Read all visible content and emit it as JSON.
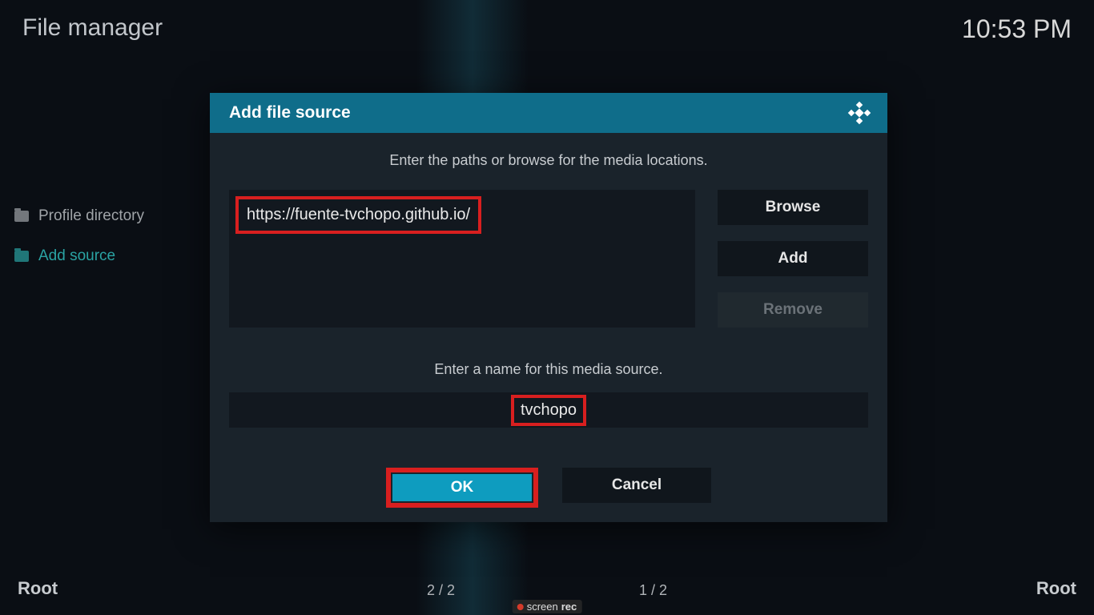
{
  "header": {
    "title": "File manager",
    "time": "10:53 PM"
  },
  "sidebar": {
    "items": [
      {
        "label": "Profile directory",
        "active": false
      },
      {
        "label": "Add source",
        "active": true
      }
    ]
  },
  "dialog": {
    "title": "Add file source",
    "paths_prompt": "Enter the paths or browse for the media locations.",
    "path_value": "https://fuente-tvchopo.github.io/",
    "buttons": {
      "browse": "Browse",
      "add": "Add",
      "remove": "Remove"
    },
    "name_prompt": "Enter a name for this media source.",
    "name_value": "tvchopo",
    "ok_label": "OK",
    "cancel_label": "Cancel"
  },
  "footer": {
    "left_label": "Root",
    "right_label": "Root",
    "left_counter": "2 / 2",
    "right_counter": "1 / 2"
  },
  "watermark": {
    "brand_a": "screen",
    "brand_b": "rec"
  }
}
